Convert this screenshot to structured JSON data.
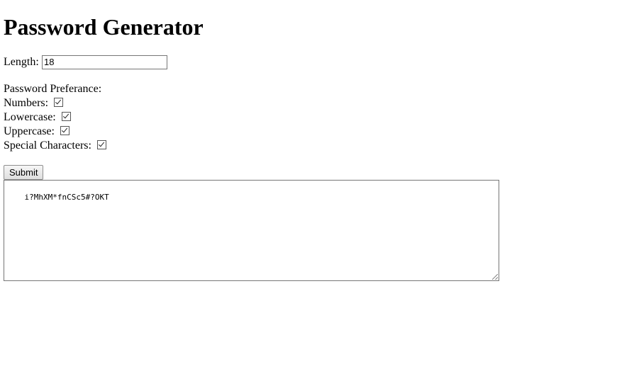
{
  "page": {
    "title": "Password Generator"
  },
  "form": {
    "length_label": "Length:",
    "length_value": "18",
    "preference_title": "Password Preferance:",
    "options": [
      {
        "label": "Numbers:",
        "checked": true
      },
      {
        "label": "Lowercase:",
        "checked": true
      },
      {
        "label": "Uppercase:",
        "checked": true
      },
      {
        "label": "Special Characters:",
        "checked": true
      }
    ],
    "submit_label": "Submit"
  },
  "output": {
    "password": "i?MhXM*fnCSc5#?OKT"
  }
}
